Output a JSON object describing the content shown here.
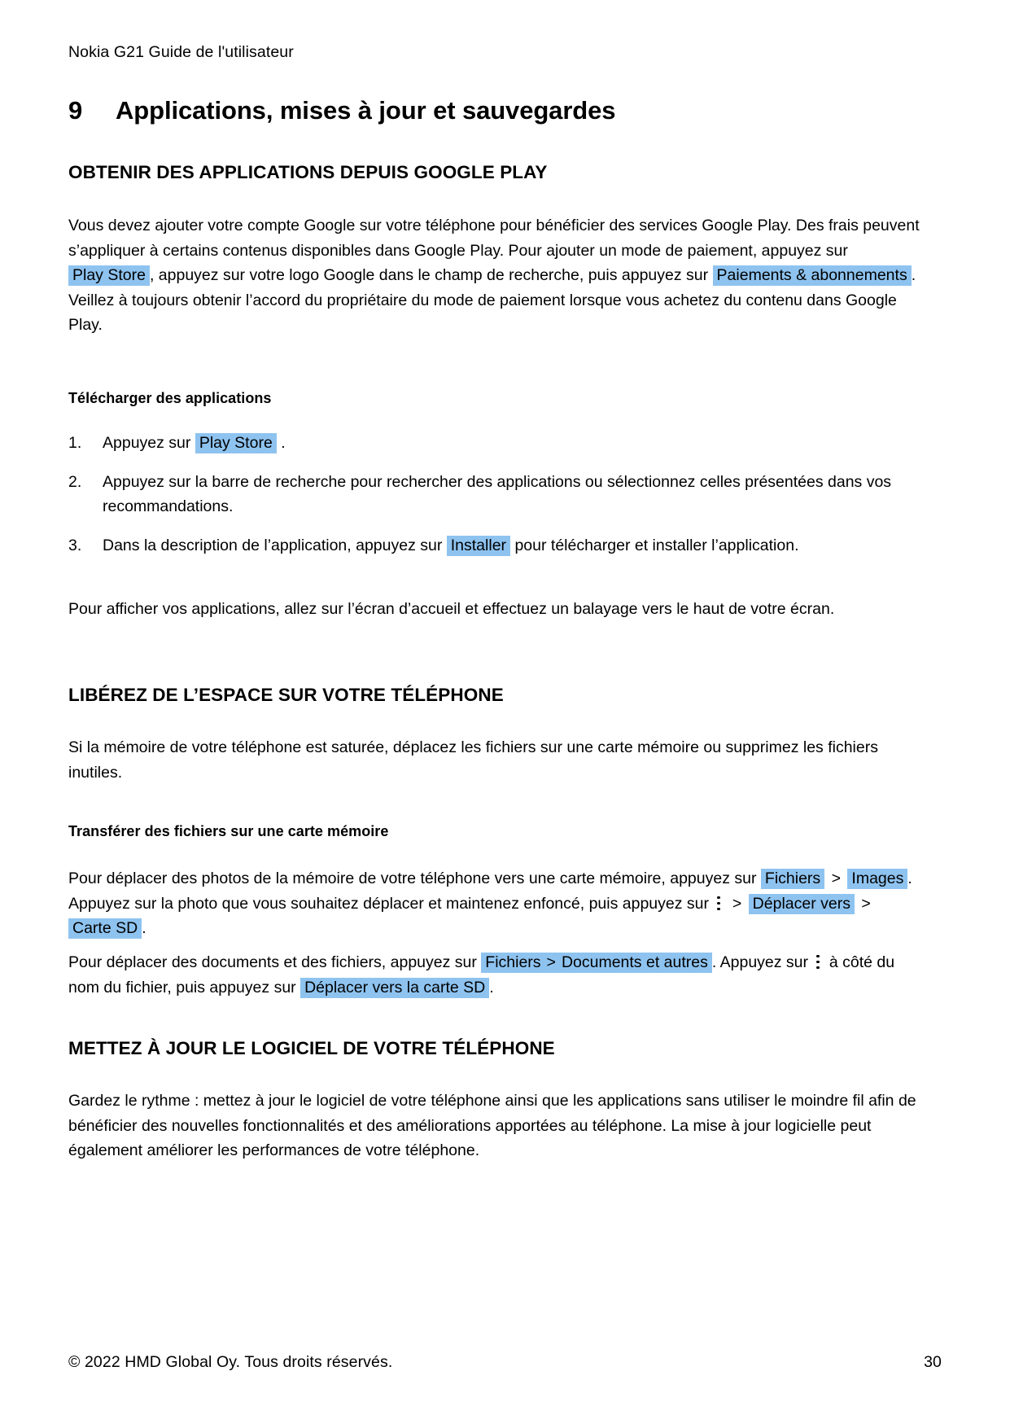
{
  "document": {
    "running_header": "Nokia G21 Guide de l'utilisateur",
    "chapter_number": "9",
    "chapter_title": "Applications, mises à jour et sauvegardes"
  },
  "colors": {
    "ui_highlight": "#8ec3f0",
    "text": "#000000",
    "page_background": "#ffffff"
  },
  "sections": {
    "google_play": {
      "heading": "OBTENIR DES APPLICATIONS DEPUIS GOOGLE PLAY",
      "intro": {
        "t1": "Vous devez ajouter votre compte Google sur votre téléphone pour bénéficier des services Google Play. Des frais peuvent s’appliquer à certains contenus disponibles dans Google Play. Pour ajouter un mode de paiement, appuyez sur",
        "ui1": "Play Store",
        "t2": ", appuyez sur votre logo Google dans le champ de recherche, puis appuyez sur",
        "ui2": "Paiements & abonnements",
        "t3": ". Veillez à toujours obtenir l’accord du propriétaire du mode de paiement lorsque vous achetez du contenu dans Google Play."
      },
      "subheading_download": "Télécharger des applications",
      "steps": [
        {
          "num": "1.",
          "t1": "Appuyez sur",
          "ui1": "Play Store",
          "t2": "."
        },
        {
          "num": "2.",
          "t1": "Appuyez sur la barre de recherche pour rechercher des applications ou sélectionnez celles présentées dans vos recommandations."
        },
        {
          "num": "3.",
          "t1": "Dans la description de l’application, appuyez sur",
          "ui1": "Installer",
          "t2": "pour télécharger et installer l’application."
        }
      ],
      "after_steps": "Pour afficher vos applications, allez sur l’écran d’accueil et effectuez un balayage vers le haut de votre écran."
    },
    "free_space": {
      "heading": "LIBÉREZ DE L’ESPACE SUR VOTRE TÉLÉPHONE",
      "intro": "Si la mémoire de votre téléphone est saturée, déplacez les fichiers sur une carte mémoire ou supprimez les fichiers inutiles.",
      "subheading_transfer": "Transférer des fichiers sur une carte mémoire",
      "photos": {
        "t1": "Pour déplacer des photos de la mémoire de votre téléphone vers une carte mémoire, appuyez sur",
        "ui1": "Fichiers",
        "sep1": ">",
        "ui2": "Images",
        "t2": ". Appuyez sur la photo que vous souhaitez déplacer et maintenez enfoncé, puis appuyez sur",
        "icon1": "kebab-menu-icon",
        "sep2": ">",
        "ui3": "Déplacer vers",
        "sep3": ">",
        "ui4": "Carte SD",
        "t3": "."
      },
      "documents": {
        "t1": "Pour déplacer des documents et des fichiers, appuyez sur",
        "ui1": "Fichiers",
        "sep1": ">",
        "ui2": "Documents et autres",
        "t2": ". Appuyez sur",
        "icon1": "kebab-menu-icon",
        "t3": "à côté du nom du fichier, puis appuyez sur",
        "ui3": "Déplacer vers la carte SD",
        "t4": "."
      }
    },
    "software_update": {
      "heading": "METTEZ À JOUR LE LOGICIEL DE VOTRE TÉLÉPHONE",
      "intro": "Gardez le rythme : mettez à jour le logiciel de votre téléphone ainsi que les applications sans utiliser le moindre fil afin de bénéficier des nouvelles fonctionnalités et des améliorations apportées au téléphone. La mise à jour logicielle peut également améliorer les performances de votre téléphone."
    }
  },
  "footer": {
    "copyright": "© 2022 HMD Global Oy. Tous droits réservés.",
    "page_number": "30"
  }
}
